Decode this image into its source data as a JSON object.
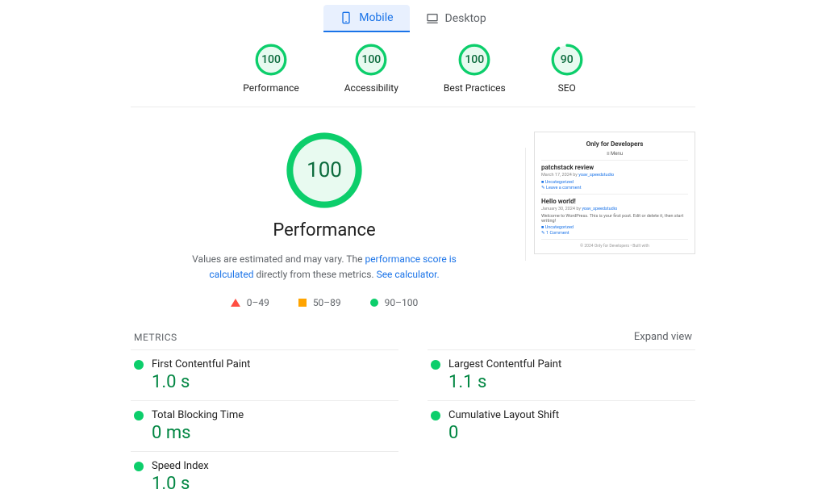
{
  "tabs": {
    "mobile": "Mobile",
    "desktop": "Desktop"
  },
  "categories": [
    {
      "label": "Performance",
      "score": "100",
      "pct": 100
    },
    {
      "label": "Accessibility",
      "score": "100",
      "pct": 100
    },
    {
      "label": "Best Practices",
      "score": "100",
      "pct": 100
    },
    {
      "label": "SEO",
      "score": "90",
      "pct": 90
    }
  ],
  "hero": {
    "score": "100",
    "title": "Performance",
    "desc_pre": "Values are estimated and may vary. The ",
    "desc_link1": "performance score is calculated",
    "desc_mid": " directly from these metrics. ",
    "desc_link2": "See calculator."
  },
  "legend": {
    "r1": "0–49",
    "r2": "50–89",
    "r3": "90–100"
  },
  "thumb": {
    "title": "Only for Developers",
    "menu": "≡ Menu",
    "post1_title": "patchstack review",
    "post1_meta": "March 17, 2024 by ",
    "post1_author": "yoav_speedstudio",
    "cat": "Uncategorized",
    "comment1": "Leave a comment",
    "post2_title": "Hello world!",
    "post2_meta": "January 30, 2024 by ",
    "post2_body": "Welcome to WordPress. This is your first post. Edit or delete it, then start writing!",
    "comment2": "1 Comment",
    "footer": "© 2024 Only for Developers • Built with"
  },
  "metrics_label": "METRICS",
  "expand": "Expand view",
  "metrics": [
    {
      "name": "First Contentful Paint",
      "value": "1.0 s"
    },
    {
      "name": "Largest Contentful Paint",
      "value": "1.1 s"
    },
    {
      "name": "Total Blocking Time",
      "value": "0 ms"
    },
    {
      "name": "Cumulative Layout Shift",
      "value": "0"
    },
    {
      "name": "Speed Index",
      "value": "1.0 s"
    }
  ]
}
